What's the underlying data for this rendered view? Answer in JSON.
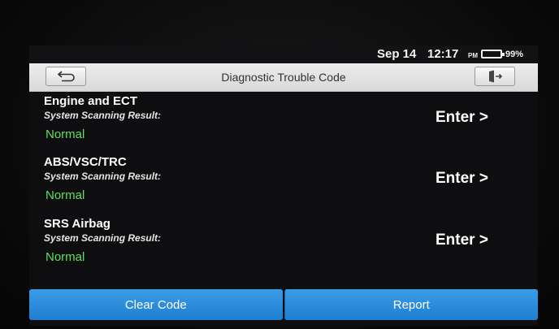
{
  "status_bar": {
    "date": "Sep 14",
    "time": "12:17",
    "ampm": "PM",
    "battery_percent": "99%"
  },
  "title_bar": {
    "title": "Diagnostic Trouble Code",
    "back_icon": "back-arrow-icon",
    "exit_icon": "exit-door-icon"
  },
  "systems": [
    {
      "name": "Engine and ECT",
      "subtitle": "System Scanning Result:",
      "status": "Normal",
      "action": "Enter >"
    },
    {
      "name": "ABS/VSC/TRC",
      "subtitle": "System Scanning Result:",
      "status": "Normal",
      "action": "Enter >"
    },
    {
      "name": "SRS Airbag",
      "subtitle": "System Scanning Result:",
      "status": "Normal",
      "action": "Enter >"
    }
  ],
  "bottom_buttons": {
    "clear_label": "Clear Code",
    "report_label": "Report"
  },
  "colors": {
    "status_ok": "#5ee05a",
    "button_blue": "#2a8ddb"
  }
}
